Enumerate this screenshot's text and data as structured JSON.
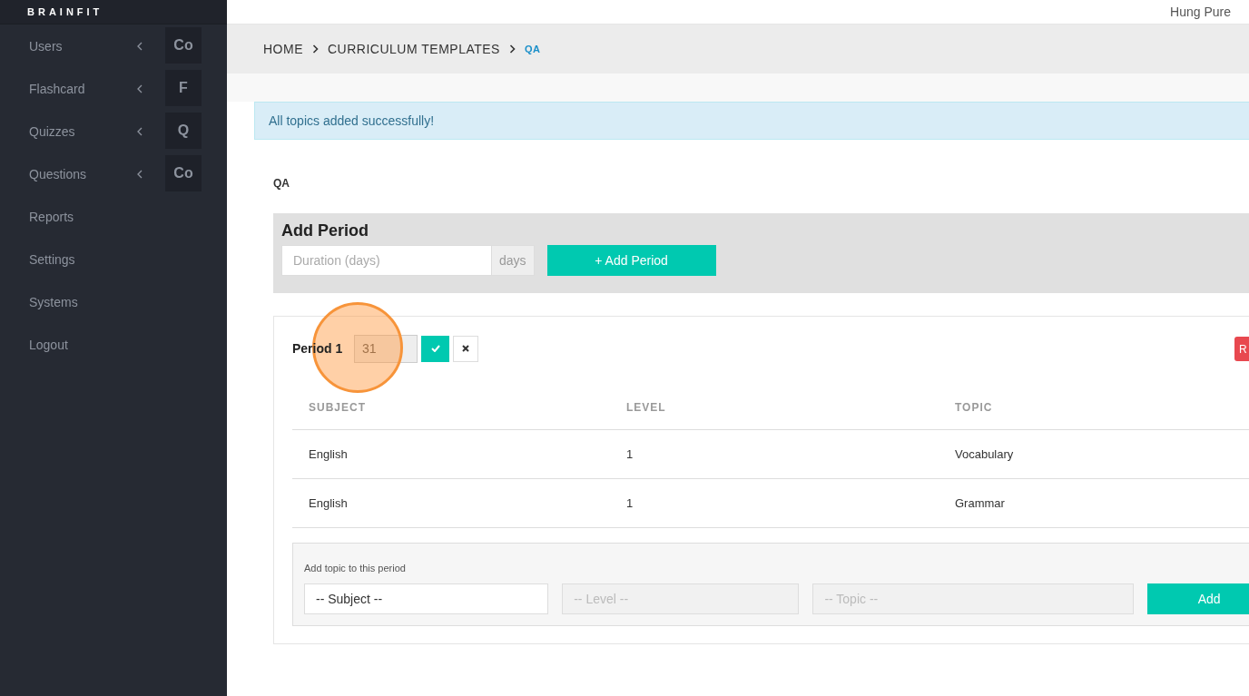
{
  "sidebar": {
    "logo": "BRAINFIT",
    "items": [
      {
        "label": "Users",
        "expandable": true,
        "badge": "Co"
      },
      {
        "label": "Flashcard",
        "expandable": true,
        "badge": "F"
      },
      {
        "label": "Quizzes",
        "expandable": true,
        "badge": "Q"
      },
      {
        "label": "Questions",
        "expandable": true,
        "badge": "Co"
      },
      {
        "label": "Reports",
        "expandable": false
      },
      {
        "label": "Settings",
        "expandable": false
      },
      {
        "label": "Systems",
        "expandable": false
      },
      {
        "label": "Logout",
        "expandable": false
      }
    ]
  },
  "header": {
    "user": "Hung Pure"
  },
  "breadcrumb": [
    "HOME",
    "CURRICULUM TEMPLATES",
    "QA"
  ],
  "alert": "All topics added successfully!",
  "template_name": "QA",
  "add_period": {
    "title": "Add Period",
    "placeholder": "Duration (days)",
    "addon": "days",
    "button": "+ Add Period"
  },
  "period": {
    "label": "Period 1",
    "duration": "31",
    "remove_button": "R",
    "columns": [
      "SUBJECT",
      "LEVEL",
      "TOPIC"
    ],
    "rows": [
      [
        "English",
        "1",
        "Vocabulary"
      ],
      [
        "English",
        "1",
        "Grammar"
      ]
    ],
    "add_topic": {
      "label": "Add topic to this period",
      "subject": "-- Subject --",
      "level_placeholder": "-- Level --",
      "topic_placeholder": "-- Topic --",
      "button": "Add"
    }
  }
}
